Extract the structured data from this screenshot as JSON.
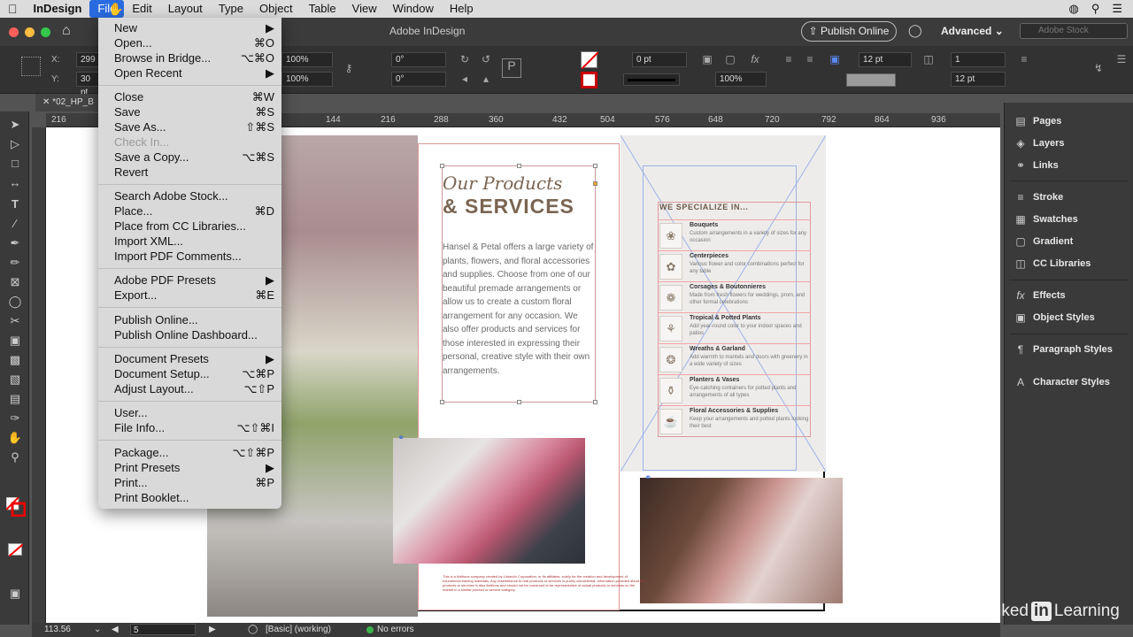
{
  "menubar": {
    "app": "InDesign",
    "items": [
      "File",
      "Edit",
      "Layout",
      "Type",
      "Object",
      "Table",
      "View",
      "Window",
      "Help"
    ]
  },
  "appbar": {
    "title": "Adobe InDesign",
    "publish": "Publish Online",
    "workspace": "Advanced",
    "stock_placeholder": "Adobe Stock"
  },
  "control": {
    "x": "299",
    "y": "30 pt",
    "scale_x": "100%",
    "scale_y": "100%",
    "angle1": "0°",
    "angle2": "0°",
    "stroke": "0 pt",
    "opacity": "100%",
    "gap1": "12 pt",
    "gap2": "12 pt",
    "cols": "1"
  },
  "doc_tab": "*02_HP_B",
  "rulers": {
    "h": [
      "216",
      "144",
      "216",
      "288",
      "360",
      "432",
      "504",
      "576",
      "648",
      "720",
      "792",
      "864",
      "936"
    ]
  },
  "file_menu": {
    "items": [
      {
        "label": "New",
        "shortcut": "▶"
      },
      {
        "label": "Open...",
        "shortcut": "⌘O"
      },
      {
        "label": "Browse in Bridge...",
        "shortcut": "⌥⌘O"
      },
      {
        "label": "Open Recent",
        "shortcut": "▶"
      },
      {
        "label": "Close",
        "shortcut": "⌘W"
      },
      {
        "label": "Save",
        "shortcut": "⌘S"
      },
      {
        "label": "Save As...",
        "shortcut": "⇧⌘S"
      },
      {
        "label": "Check In...",
        "shortcut": ""
      },
      {
        "label": "Save a Copy...",
        "shortcut": "⌥⌘S"
      },
      {
        "label": "Revert",
        "shortcut": ""
      },
      {
        "label": "Search Adobe Stock...",
        "shortcut": ""
      },
      {
        "label": "Place...",
        "shortcut": "⌘D"
      },
      {
        "label": "Place from CC Libraries...",
        "shortcut": ""
      },
      {
        "label": "Import XML...",
        "shortcut": ""
      },
      {
        "label": "Import PDF Comments...",
        "shortcut": ""
      },
      {
        "label": "Adobe PDF Presets",
        "shortcut": "▶"
      },
      {
        "label": "Export...",
        "shortcut": "⌘E"
      },
      {
        "label": "Publish Online...",
        "shortcut": ""
      },
      {
        "label": "Publish Online Dashboard...",
        "shortcut": ""
      },
      {
        "label": "Document Presets",
        "shortcut": "▶"
      },
      {
        "label": "Document Setup...",
        "shortcut": "⌥⌘P"
      },
      {
        "label": "Adjust Layout...",
        "shortcut": "⌥⇧P"
      },
      {
        "label": "User...",
        "shortcut": ""
      },
      {
        "label": "File Info...",
        "shortcut": "⌥⇧⌘I"
      },
      {
        "label": "Package...",
        "shortcut": "⌥⇧⌘P"
      },
      {
        "label": "Print Presets",
        "shortcut": "▶"
      },
      {
        "label": "Print...",
        "shortcut": "⌘P"
      },
      {
        "label": "Print Booklet...",
        "shortcut": ""
      }
    ]
  },
  "right_panel": {
    "items": [
      "Pages",
      "Layers",
      "Links",
      "Stroke",
      "Swatches",
      "Gradient",
      "CC Libraries",
      "Effects",
      "Object Styles",
      "Paragraph Styles",
      "Character Styles"
    ]
  },
  "doc": {
    "headline1": "Our Products",
    "headline2": "& SERVICES",
    "body": "Hansel & Petal offers a large variety of plants, flowers, and floral accessories and supplies. Choose from one of our beautiful premade arrangements or allow us to create a custom floral arrangement for any occasion. We also offer products and services for those interested in expressing their personal, creative style with their own arrangements.",
    "specialize": "WE SPECIALIZE IN...",
    "services": [
      {
        "name": "Bouquets",
        "desc": "Custom arrangements in a variety of sizes for any occasion"
      },
      {
        "name": "Centerpieces",
        "desc": "Various flower and color combinations perfect for any table"
      },
      {
        "name": "Corsages & Boutonnieres",
        "desc": "Made from fresh flowers for weddings, prom, and other formal celebrations"
      },
      {
        "name": "Tropical & Potted Plants",
        "desc": "Add year-round color to your indoor spaces and patios"
      },
      {
        "name": "Wreaths & Garland",
        "desc": "Add warmth to mantels and doors with greenery in a wide variety of sizes"
      },
      {
        "name": "Planters & Vases",
        "desc": "Eye-catching containers for potted plants and arrangements of all types"
      },
      {
        "name": "Floral Accessories & Supplies",
        "desc": "Keep your arrangements and potted plants looking their best"
      }
    ],
    "disclaimer": "This is a fictitious company created by LinkedIn Corporation, or its affiliates, solely for the creation and development of educational training materials. Any resemblance to real products or services is purely coincidental. Information provided about the products or services is also fictitious and should not be construed to be representative of actual products or services on the market in a similar product or service category."
  },
  "status": {
    "zoom": "113.56",
    "page": "5",
    "style": "[Basic] (working)",
    "errors": "No errors"
  },
  "watermark": {
    "left": "Linked",
    "in": "in",
    "right": "Learning"
  }
}
